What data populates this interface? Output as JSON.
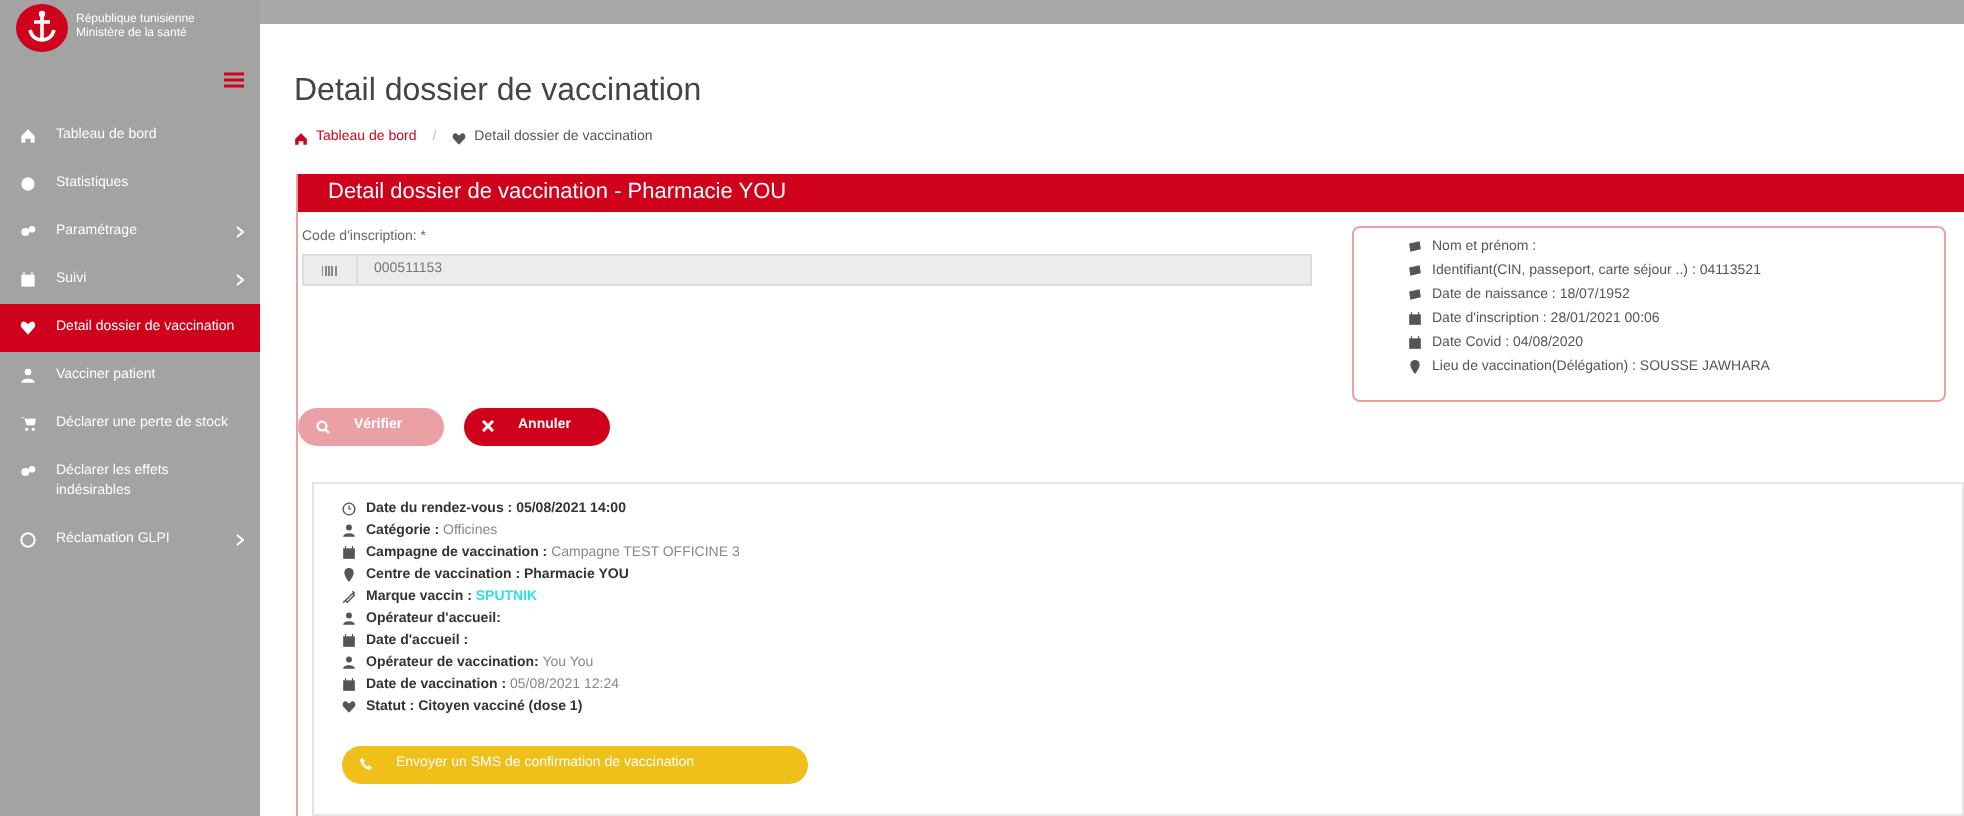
{
  "brand": {
    "line_1": "République tunisienne",
    "line_2": "Ministère de la santé"
  },
  "sidebar": {
    "items": [
      {
        "label": "Tableau de bord",
        "submenu": false,
        "selected": false
      },
      {
        "label": "Statistiques",
        "submenu": false,
        "selected": false
      },
      {
        "label": "Paramétrage",
        "submenu": true,
        "selected": false
      },
      {
        "label": "Suivi",
        "submenu": true,
        "selected": false
      },
      {
        "label": "Detail dossier de vaccination",
        "submenu": false,
        "selected": true
      },
      {
        "label": "Vacciner patient",
        "submenu": false,
        "selected": false
      },
      {
        "label": "Déclarer une perte de stock",
        "submenu": false,
        "selected": false
      },
      {
        "label": "Déclarer les effets indésirables",
        "submenu": false,
        "selected": false
      },
      {
        "label": "Réclamation GLPI",
        "submenu": true,
        "selected": false
      }
    ]
  },
  "page_title": "Detail dossier de vaccination",
  "breadcrumb": {
    "separator": "/",
    "items": [
      {
        "label": "Tableau de bord",
        "link": true
      },
      {
        "label": "Detail dossier de vaccination",
        "link": false
      }
    ]
  },
  "panel": {
    "title": "Detail dossier de vaccination - Pharmacie YOU",
    "field": {
      "label": "Code d'inscription: *",
      "value": "000511153"
    },
    "patient": [
      "Nom et prénom :",
      "Identifiant(CIN, passeport, carte séjour ..) : 04113521",
      "Date de naissance : 18/07/1952",
      "Date d'inscription : 28/01/2021 00:06",
      "Date Covid : 04/08/2020",
      "Lieu de vaccination(Délégation) : SOUSSE JAWHARA"
    ],
    "buttons": [
      {
        "label": "Vérifier",
        "disabled": true
      },
      {
        "label": "Annuler",
        "disabled": false
      }
    ]
  },
  "details": [
    {
      "label": "Date du rendez-vous :",
      "value": "**05/08/2021 14:00**"
    },
    {
      "label": "Catégorie :",
      "value": "Officines"
    },
    {
      "label": "Campagne de vaccination :",
      "value": "Campagne TEST OFFICINE 3"
    },
    {
      "label": "Centre de vaccination :",
      "value": "**Pharmacie YOU**"
    },
    {
      "label": "Marque vaccin :",
      "value": "**SPUTNIK**",
      "color": "#2de0e6"
    },
    {
      "label": "Opérateur d'accueil:"
    },
    {
      "label": "Date d'accueil :"
    },
    {
      "label": "Opérateur de vaccination:",
      "value": "You You"
    },
    {
      "label": "Date de vaccination :",
      "value": "05/08/2021 12:24"
    },
    {
      "label": "Statut :",
      "value": "**Citoyen vacciné (dose 1)**"
    }
  ],
  "sms_button": "Envoyer un SMS de confirmation de vaccination"
}
